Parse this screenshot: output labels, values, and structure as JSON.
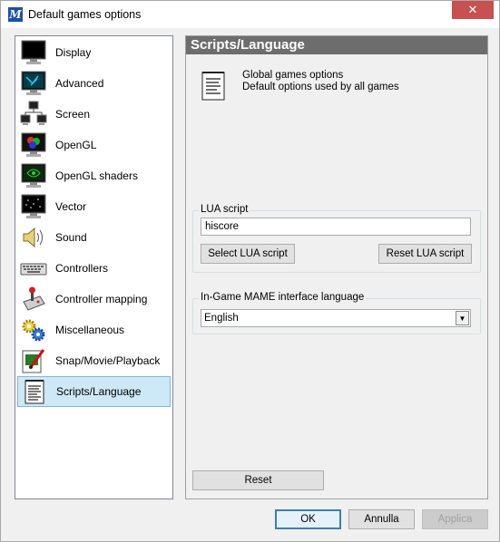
{
  "window": {
    "title": "Default games options",
    "close_label": "✕"
  },
  "sidebar": {
    "items": [
      {
        "label": "Display",
        "icon": "monitor-icon"
      },
      {
        "label": "Advanced",
        "icon": "advanced-monitor-icon"
      },
      {
        "label": "Screen",
        "icon": "network-screens-icon"
      },
      {
        "label": "OpenGL",
        "icon": "opengl-icon"
      },
      {
        "label": "OpenGL shaders",
        "icon": "opengl-shaders-icon"
      },
      {
        "label": "Vector",
        "icon": "vector-icon"
      },
      {
        "label": "Sound",
        "icon": "speaker-icon"
      },
      {
        "label": "Controllers",
        "icon": "keyboard-icon"
      },
      {
        "label": "Controller mapping",
        "icon": "joystick-icon"
      },
      {
        "label": "Miscellaneous",
        "icon": "gears-icon"
      },
      {
        "label": "Snap/Movie/Playback",
        "icon": "snap-movie-icon"
      },
      {
        "label": "Scripts/Language",
        "icon": "document-icon"
      }
    ],
    "selected_index": 11
  },
  "panel": {
    "title": "Scripts/Language",
    "global_line1": "Global games options",
    "global_line2": "Default options used by all games",
    "lua_group_label": "LUA script",
    "lua_value": "hiscore",
    "select_lua_label": "Select LUA script",
    "reset_lua_label": "Reset LUA script",
    "lang_group_label": "In-Game MAME interface language",
    "lang_value": "English",
    "reset_label": "Reset"
  },
  "footer": {
    "ok_label": "OK",
    "cancel_label": "Annulla",
    "apply_label": "Applica"
  },
  "colors": {
    "selection_bg": "#cde8f7",
    "header_bg": "#6d6d6d",
    "close_bg": "#c75050"
  }
}
